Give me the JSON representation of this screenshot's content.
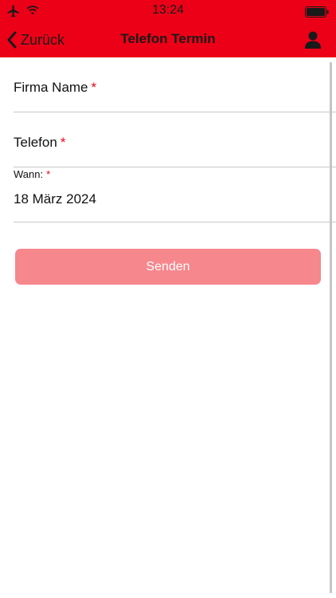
{
  "status_bar": {
    "time": "13:24"
  },
  "nav": {
    "back_label": "Zurück",
    "title": "Telefon Termin"
  },
  "form": {
    "firma_name": {
      "label": "Firma Name",
      "required_mark": "*"
    },
    "telefon": {
      "label": "Telefon",
      "required_mark": "*"
    },
    "wann": {
      "label": "Wann:",
      "required_mark": "*",
      "value": "18 März 2024"
    },
    "submit_label": "Senden"
  },
  "colors": {
    "accent": "#ec0017",
    "button_disabled": "#f6878d",
    "required": "#ec0017"
  },
  "icons": [
    "airplane-icon",
    "wifi-icon",
    "battery-icon",
    "chevron-left-icon",
    "user-icon"
  ]
}
